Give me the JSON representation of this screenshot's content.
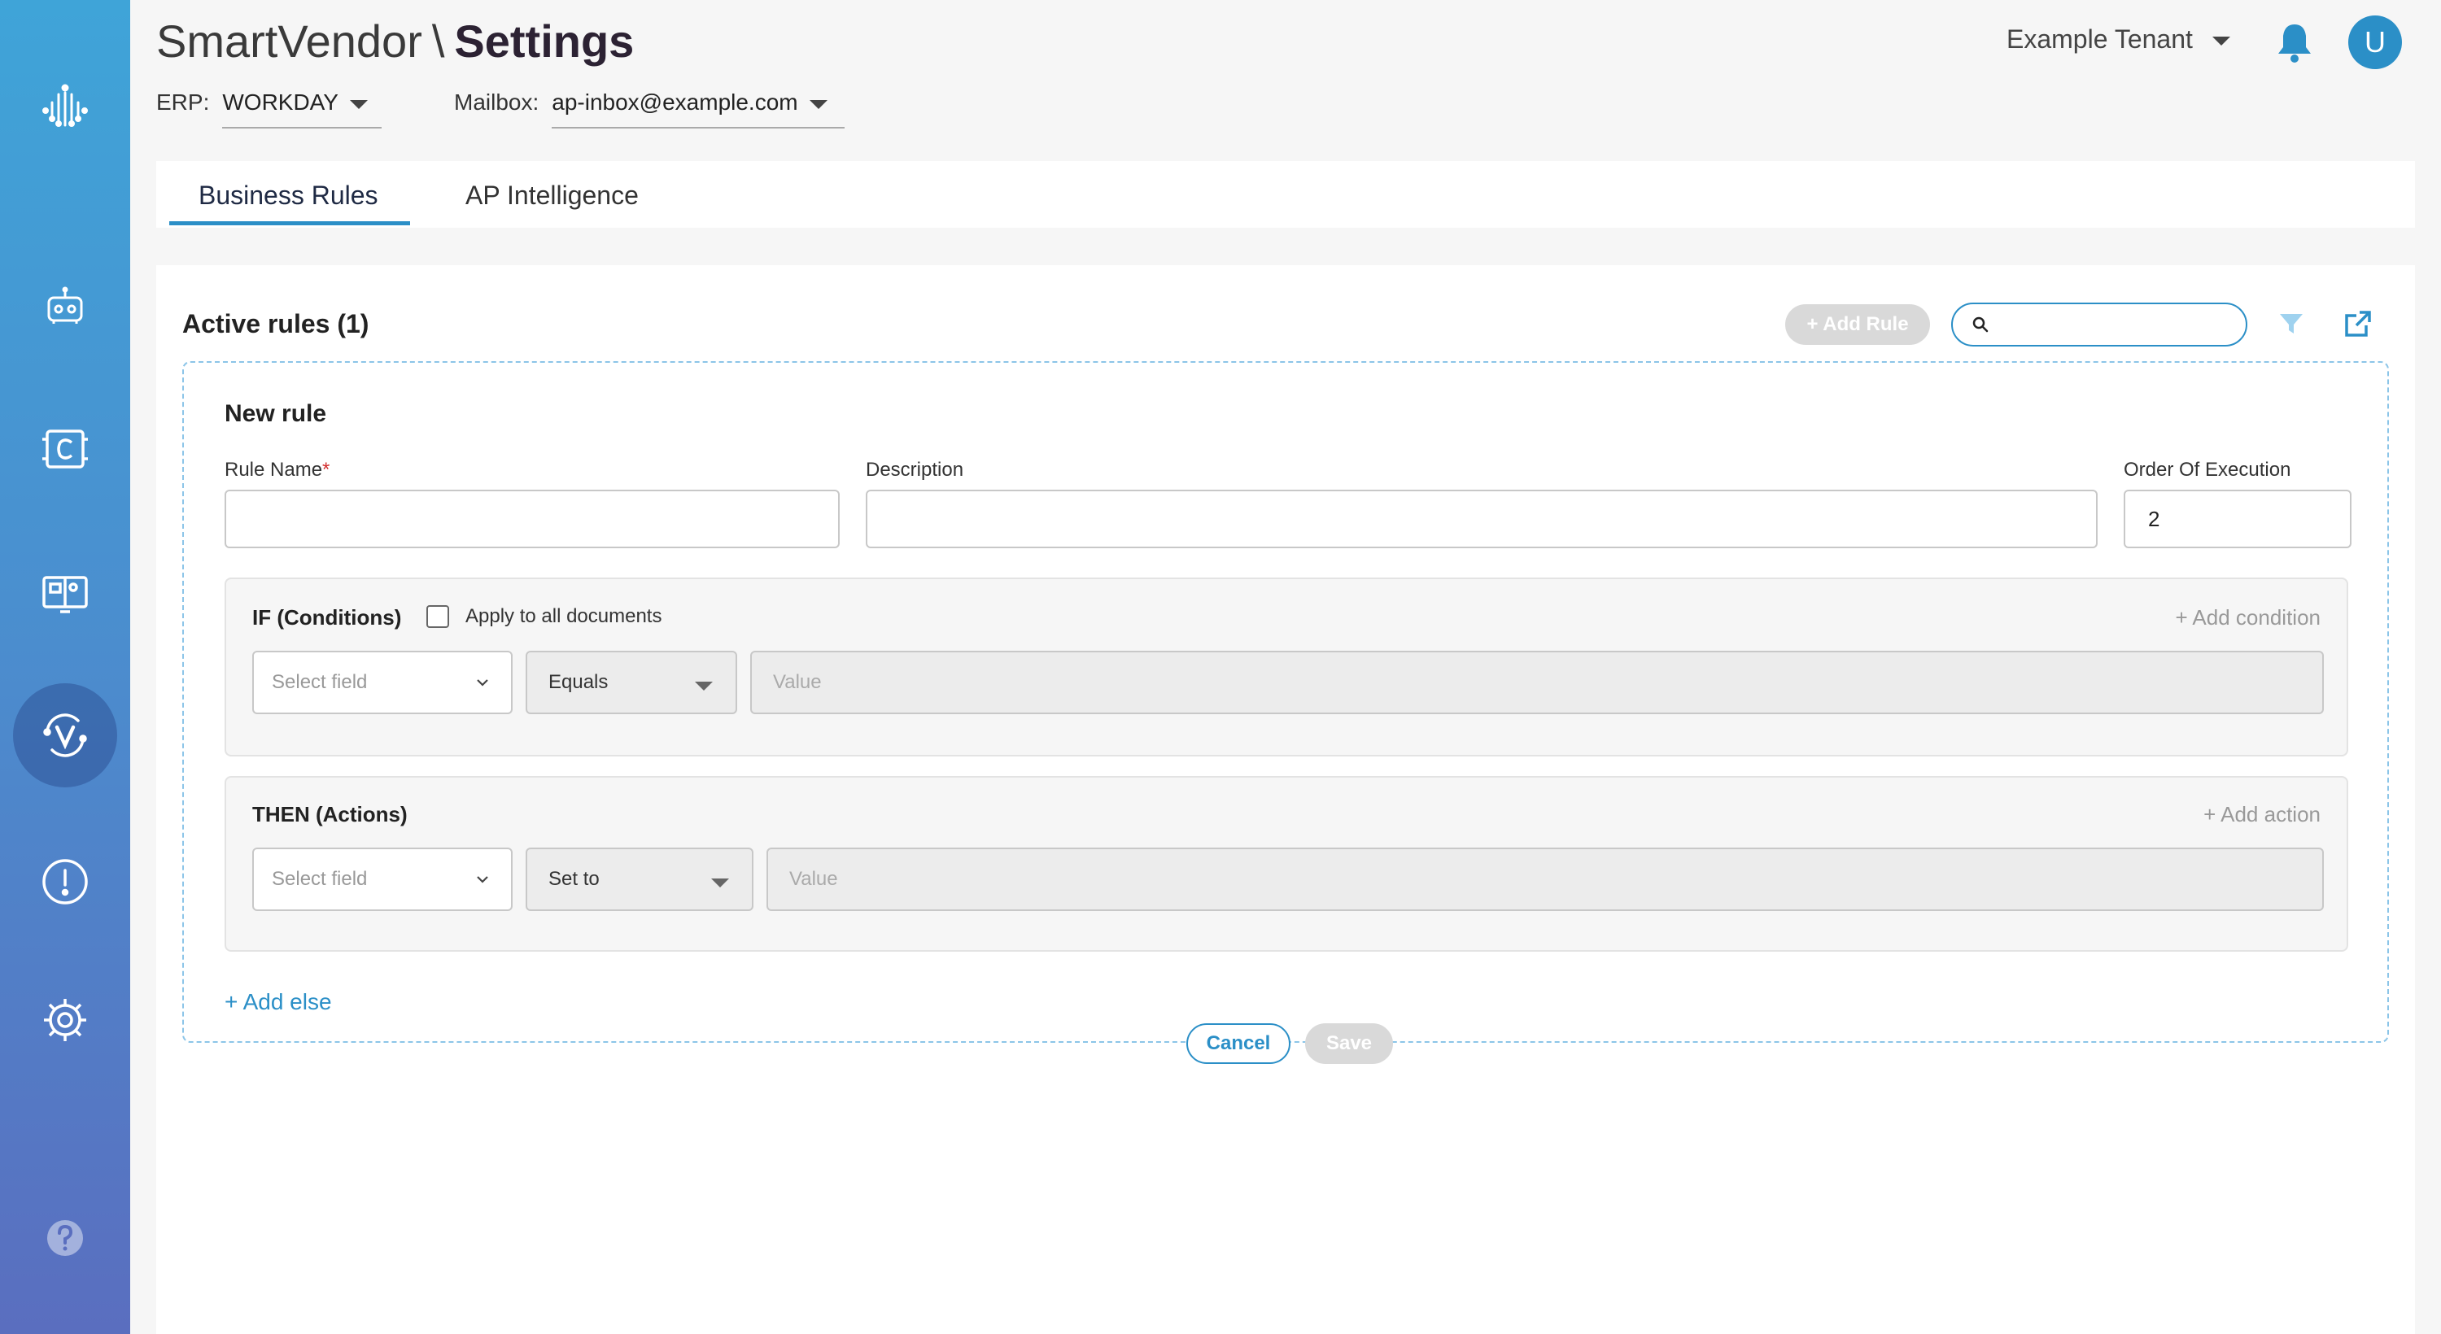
{
  "header": {
    "app_name": "SmartVendor",
    "separator": "\\",
    "page_title": "Settings",
    "erp_label": "ERP:",
    "erp_value": "WORKDAY",
    "mailbox_label": "Mailbox:",
    "mailbox_value": "ap-inbox@example.com",
    "tenant": "Example Tenant",
    "avatar_initial": "U"
  },
  "sidebar": {
    "items": [
      {
        "icon": "logo-icon"
      },
      {
        "icon": "robot-icon"
      },
      {
        "icon": "document-c-icon"
      },
      {
        "icon": "book-icon"
      },
      {
        "icon": "vendor-v-icon",
        "active": true
      },
      {
        "icon": "alert-icon"
      },
      {
        "icon": "gear-icon"
      },
      {
        "icon": "help-icon"
      }
    ]
  },
  "tabs": [
    {
      "label": "Business Rules",
      "active": true
    },
    {
      "label": "AP Intelligence",
      "active": false
    }
  ],
  "rules": {
    "active_title": "Active rules (1)",
    "add_rule_label": "+ Add Rule",
    "search_value": "",
    "new_rule_title": "New rule",
    "rule_name_label": "Rule Name",
    "required_mark": "*",
    "rule_name_value": "",
    "description_label": "Description",
    "description_value": "",
    "order_label": "Order Of Execution",
    "order_value": "2",
    "conditions": {
      "title": "IF (Conditions)",
      "apply_all_label": "Apply to all documents",
      "apply_all_checked": false,
      "add_label": "+ Add condition",
      "field_placeholder": "Select field",
      "operator": "Equals",
      "value_placeholder": "Value"
    },
    "actions": {
      "title": "THEN (Actions)",
      "add_label": "+ Add action",
      "field_placeholder": "Select field",
      "operator": "Set to",
      "value_placeholder": "Value"
    },
    "add_else_label": "+ Add else",
    "cancel_label": "Cancel",
    "save_label": "Save"
  },
  "colors": {
    "accent": "#2b8fc7",
    "sidebar_top": "#3fa4d8",
    "sidebar_bottom": "#5a6ebf",
    "disabled": "#d9d9d9",
    "required": "#d32f2f"
  }
}
